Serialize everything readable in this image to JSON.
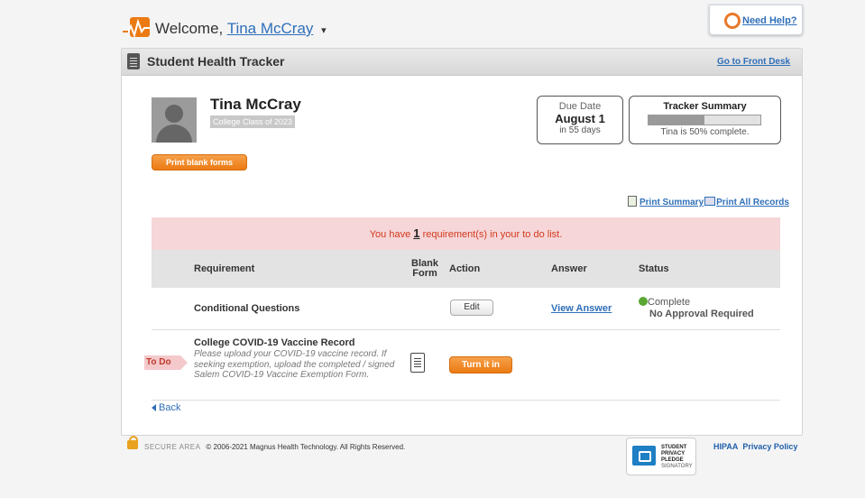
{
  "header": {
    "welcome": "Welcome,",
    "user_name": "Tina McCray",
    "need_help": "Need Help?"
  },
  "panel": {
    "title": "Student Health Tracker",
    "front_desk_link": "Go to Front Desk"
  },
  "profile": {
    "name": "Tina McCray",
    "class": "College Class of 2023",
    "print_blank_forms": "Print blank forms"
  },
  "due": {
    "label": "Due Date",
    "date": "August 1",
    "days": "in 55 days"
  },
  "summary": {
    "title": "Tracker Summary",
    "progress": 0.5,
    "text": "Tina is 50% complete."
  },
  "print_links": {
    "summary": "Print Summary",
    "all_records": "Print All Records"
  },
  "alert": {
    "prefix": "You have",
    "count": "1",
    "suffix": "requirement(s) in your to do list."
  },
  "table": {
    "headers": {
      "requirement": "Requirement",
      "blank_form_1": "Blank",
      "blank_form_2": "Form",
      "action": "Action",
      "answer": "Answer",
      "status": "Status"
    },
    "rows": [
      {
        "requirement": "Conditional Questions",
        "action": "Edit",
        "answer": "View Answer",
        "status_1": "Complete",
        "status_2": "No Approval Required"
      },
      {
        "badge": "To Do",
        "requirement": "College COVID-19 Vaccine Record",
        "description": "Please upload your COVID-19 vaccine record. If seeking exemption, upload the completed / signed Salem COVID-19 Vaccine Exemption Form.",
        "action": "Turn it in"
      }
    ]
  },
  "back": "Back",
  "footer": {
    "secure": "SECURE AREA",
    "copyright": "© 2006-2021 Magnus Health Technology. All Rights Reserved.",
    "pledge_1": "STUDENT",
    "pledge_2": "PRIVACY",
    "pledge_3": "PLEDGE",
    "pledge_4": "SIGNATORY",
    "hipaa": "HIPAA",
    "privacy": "Privacy Policy"
  },
  "colors": {
    "accent_orange": "#ec7a12",
    "link_blue": "#2f6fb8",
    "alert_bg": "#f6d6d8",
    "alert_text": "#d2391d",
    "complete_green": "#5aa832"
  },
  "icons": [
    "magnus-logo-icon",
    "caret-down-icon",
    "lifering-icon",
    "clipboard-icon",
    "avatar-icon",
    "document-icon",
    "printer-icon",
    "check-circle-icon",
    "form-icon",
    "back-arrow-icon",
    "lock-icon",
    "pledge-badge-icon"
  ]
}
